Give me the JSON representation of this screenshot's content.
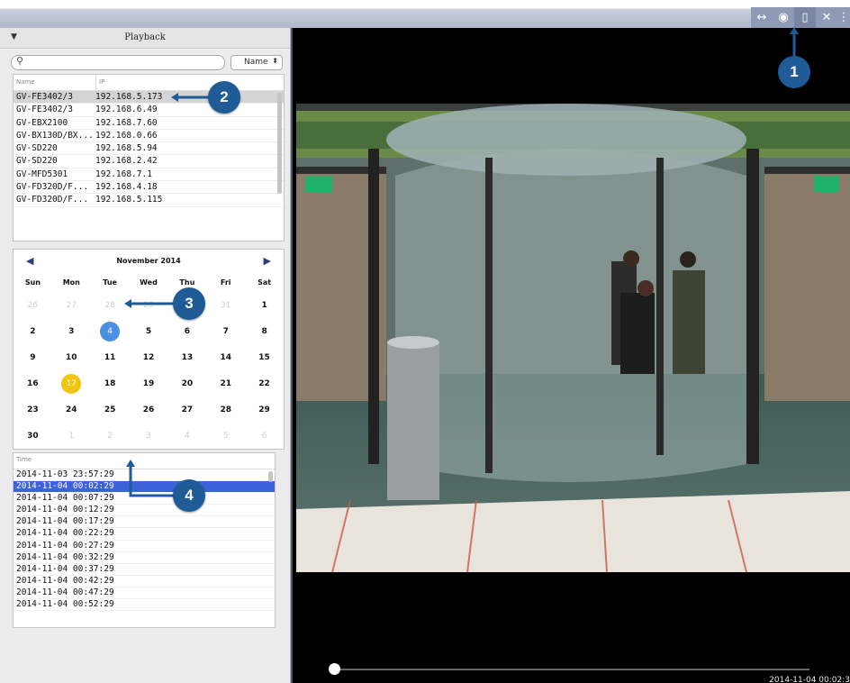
{
  "panel": {
    "title": "Playback"
  },
  "search": {
    "placeholder": ""
  },
  "sort": {
    "value": "Name"
  },
  "devices": {
    "col_name": "Name",
    "col_ip": "IP",
    "rows": [
      {
        "name": "GV-FE3402/3",
        "ip": "192.168.5.173"
      },
      {
        "name": "GV-FE3402/3",
        "ip": "192.168.6.49"
      },
      {
        "name": "GV-EBX2100",
        "ip": "192.168.7.60"
      },
      {
        "name": "GV-BX130D/BX...",
        "ip": "192.168.0.66"
      },
      {
        "name": "GV-SD220",
        "ip": "192.168.5.94"
      },
      {
        "name": "GV-SD220",
        "ip": "192.168.2.42"
      },
      {
        "name": "GV-MFD5301",
        "ip": "192.168.7.1"
      },
      {
        "name": "GV-FD320D/F...",
        "ip": "192.168.4.18"
      },
      {
        "name": "GV-FD320D/F...",
        "ip": "192.168.5.115"
      }
    ]
  },
  "calendar": {
    "month": "November 2014",
    "prev": "◀",
    "next": "▶",
    "dow": [
      "Sun",
      "Mon",
      "Tue",
      "Wed",
      "Thu",
      "Fri",
      "Sat"
    ],
    "days": [
      "26",
      "27",
      "28",
      "29",
      "30",
      "31",
      "1",
      "2",
      "3",
      "4",
      "5",
      "6",
      "7",
      "8",
      "9",
      "10",
      "11",
      "12",
      "13",
      "14",
      "15",
      "16",
      "17",
      "18",
      "19",
      "20",
      "21",
      "22",
      "23",
      "24",
      "25",
      "26",
      "27",
      "28",
      "29",
      "30",
      "1",
      "2",
      "3",
      "4",
      "5",
      "6"
    ]
  },
  "times": {
    "header": "Time",
    "rows": [
      "2014-11-03 23:57:29",
      "2014-11-04 00:02:29",
      "2014-11-04 00:07:29",
      "2014-11-04 00:12:29",
      "2014-11-04 00:17:29",
      "2014-11-04 00:22:29",
      "2014-11-04 00:27:29",
      "2014-11-04 00:32:29",
      "2014-11-04 00:37:29",
      "2014-11-04 00:42:29",
      "2014-11-04 00:47:29",
      "2014-11-04 00:52:29"
    ]
  },
  "video": {
    "timestamp": "2014-11-04 00:02:3"
  },
  "toolbar": {
    "icons": [
      "fit-icon",
      "eye-icon",
      "playback-icon",
      "tools-icon",
      "grip-icon"
    ]
  },
  "callouts": {
    "c1": "1",
    "c2": "2",
    "c3": "3",
    "c4": "4"
  },
  "colors": {
    "callout": "#1e5b97",
    "selected_row": "#3b62d8",
    "today": "#f2c510",
    "selected_day": "#4a90e2"
  }
}
